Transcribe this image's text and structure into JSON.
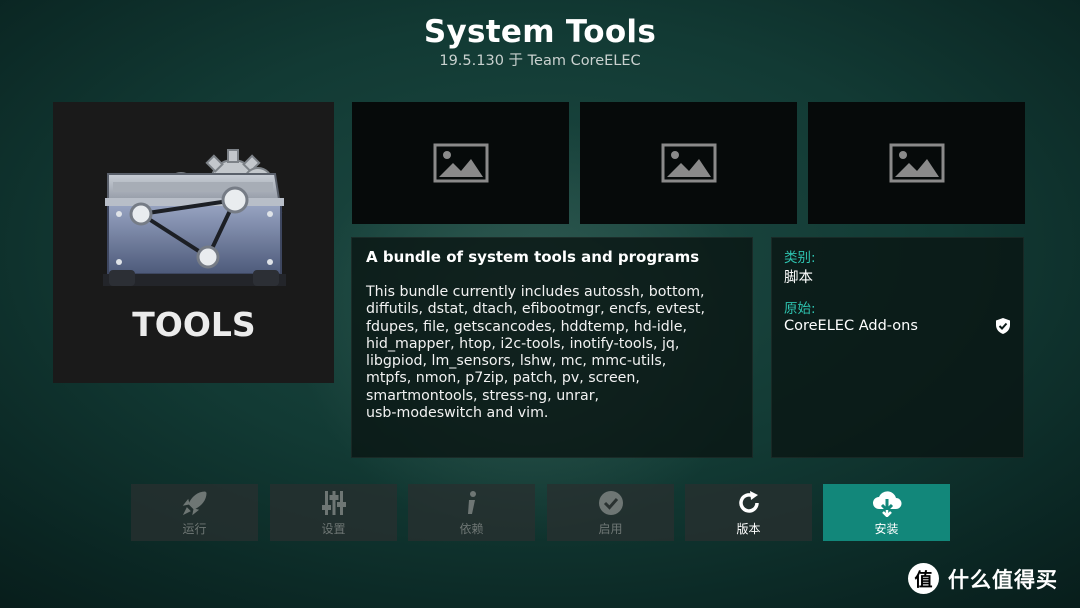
{
  "header": {
    "title": "System Tools",
    "subtitle": "19.5.130 于 Team CoreELEC"
  },
  "addon_icon": {
    "label": "TOOLS",
    "icon": "toolbox-gears-icon"
  },
  "screenshots": [
    {
      "icon": "image-placeholder-icon"
    },
    {
      "icon": "image-placeholder-icon"
    },
    {
      "icon": "image-placeholder-icon"
    }
  ],
  "description": {
    "title": "A bundle of system tools and programs",
    "body": "This bundle currently includes autossh, bottom,\ndiffutils, dstat, dtach, efibootmgr, encfs, evtest,\nfdupes, file, getscancodes, hddtemp, hd-idle,\nhid_mapper, htop, i2c-tools, inotify-tools, jq,\nlibgpiod, lm_sensors, lshw, mc, mmc-utils,\nmtpfs, nmon, p7zip, patch, pv, screen,\nsmartmontools, stress-ng, unrar,\nusb-modeswitch and vim."
  },
  "meta": {
    "category_label": "类别:",
    "category_value": "脚本",
    "origin_label": "原始:",
    "origin_value": "CoreELEC Add-ons",
    "verified_icon": "shield-check-icon"
  },
  "buttons": [
    {
      "label": "运行",
      "icon": "rocket-icon",
      "state": "disabled"
    },
    {
      "label": "设置",
      "icon": "sliders-icon",
      "state": "disabled"
    },
    {
      "label": "依赖",
      "icon": "info-icon",
      "state": "disabled"
    },
    {
      "label": "启用",
      "icon": "check-circle-icon",
      "state": "disabled"
    },
    {
      "label": "版本",
      "icon": "refresh-icon",
      "state": "enabled"
    },
    {
      "label": "安装",
      "icon": "cloud-download-icon",
      "state": "focused"
    }
  ],
  "colors": {
    "accent": "#12877a",
    "meta_label": "#2ec4b0"
  },
  "watermark": {
    "symbol": "值",
    "text": "什么值得买"
  }
}
